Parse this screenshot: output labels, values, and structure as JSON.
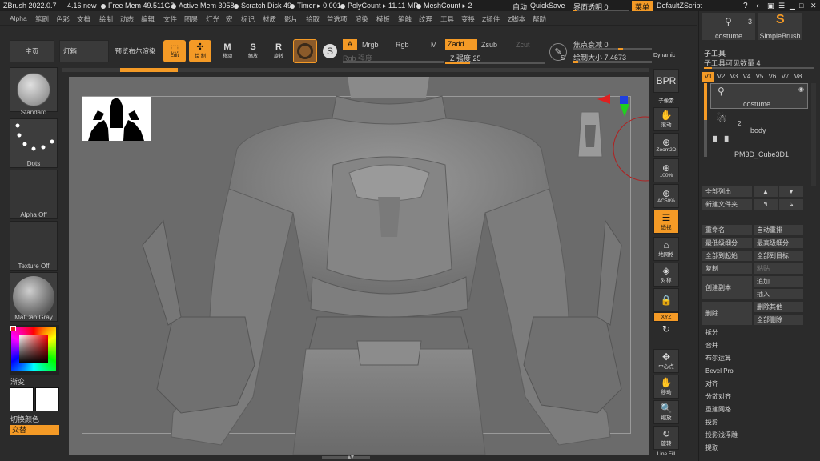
{
  "titlebar": {
    "app": "ZBrush 2022.0.7",
    "version_note": "4.16 new",
    "free_mem": "Free Mem 49.511GB",
    "active_mem": "Active Mem 3058",
    "scratch_disk": "Scratch Disk 49",
    "timer": "Timer ▸ 0.001",
    "polycount": "PolyCount ▸ 11.11 MP",
    "meshcount": "MeshCount ▸ 2",
    "auto": "自动",
    "quicksave": "QuickSave",
    "interface_transparency": "界面透明 0",
    "menu_label": "菜单",
    "script_label": "DefaultZScript"
  },
  "menubar": {
    "items": [
      "Alpha",
      "笔刷",
      "色彩",
      "文档",
      "绘制",
      "动态",
      "编辑",
      "文件",
      "图层",
      "灯光",
      "宏",
      "标记",
      "材质",
      "影片",
      "拾取",
      "首选项",
      "渲染",
      "模板",
      "笔触",
      "纹理",
      "工具",
      "变换",
      "Z插件",
      "Z脚本",
      "帮助"
    ]
  },
  "toolbar": {
    "home": "主页",
    "lightbox": "灯箱",
    "bpr_preview": "预览布尔渲染",
    "edit": "Edit",
    "draw": "绘 制",
    "move": "移动",
    "scale": "缩放",
    "rotate": "旋转",
    "a_toggle": "A",
    "mrgb": "Mrgb",
    "rgb": "Rgb",
    "m": "M",
    "zadd": "Zadd",
    "zsub": "Zsub",
    "zcut": "Zcut",
    "rgb_intensity": "Rgb 强度",
    "z_intensity": "Z 强度 25",
    "z_intensity_value": 25,
    "focal_shift": "焦点衰减 0",
    "draw_size": "绘制大小 7.4673",
    "dynamic": "Dynamic",
    "s_label": "S"
  },
  "leftcol": {
    "brush": "Standard",
    "stroke": "Dots",
    "alpha": "Alpha Off",
    "texture": "Texture Off",
    "material": "MatCap Gray",
    "gradient": "渐变",
    "switch_color": "切换颜色",
    "alternate": "交替"
  },
  "rightshelf": {
    "buttons": [
      {
        "glyph": "BPR",
        "label": ""
      },
      {
        "glyph": "",
        "label": "子像素"
      },
      {
        "glyph": "✋",
        "label": "滚动"
      },
      {
        "glyph": "⊕",
        "label": "Zoom2D"
      },
      {
        "glyph": "⊕",
        "label": "100%"
      },
      {
        "glyph": "⊕",
        "label": "AC50%"
      },
      {
        "glyph": "☰",
        "label": "透视"
      },
      {
        "glyph": "⌂",
        "label": "地网格"
      },
      {
        "glyph": "◈",
        "label": "对称"
      },
      {
        "glyph": "🔒",
        "label": ""
      },
      {
        "glyph": "",
        "label": "XYZ"
      },
      {
        "glyph": "↻",
        "label": ""
      },
      {
        "glyph": "✥",
        "label": "中心点"
      },
      {
        "glyph": "✋",
        "label": "移动"
      },
      {
        "glyph": "🔍",
        "label": "缩放"
      },
      {
        "glyph": "↻",
        "label": "旋转"
      },
      {
        "glyph": "",
        "label": "Line Fill"
      }
    ]
  },
  "rpanel": {
    "tool_top": {
      "count": "3",
      "tool_name": "costume",
      "brush_name": "SimpleBrush"
    },
    "subtool_title": "子工具",
    "subtool_visible": "子工具可见数量 4",
    "versions": [
      "V1",
      "V2",
      "V3",
      "V4",
      "V5",
      "V6",
      "V7",
      "V8"
    ],
    "subtools": [
      {
        "name": "costume"
      },
      {
        "name": "body",
        "badge": "2"
      },
      {
        "name": "PM3D_Cube3D1"
      }
    ],
    "list_all": "全部列出",
    "new_folder": "新建文件夹",
    "rename": "重命名",
    "auto_reorder": "自动重排",
    "lowest_subdiv": "最低级细分",
    "highest_subdiv": "最高级细分",
    "all_to_start": "全部到起始",
    "all_to_target": "全部到目标",
    "duplicate": "复制",
    "paste": "粘贴",
    "create_copy": "创建副本",
    "append": "追加",
    "insert": "插入",
    "delete": "删除",
    "delete_other": "删除其他",
    "delete_all": "全部删除",
    "split": "拆分",
    "merge": "合并",
    "boolean": "布尔运算",
    "bevel_pro": "Bevel Pro",
    "align": "对齐",
    "distribute": "分散对齐",
    "remesh": "重建网格",
    "project": "投影",
    "project_bas": "投影浅浮雕",
    "extract": "提取"
  },
  "colors": {
    "accent": "#f49a26",
    "panel": "#2b2b2b",
    "viewport": "#6b6b6b"
  }
}
